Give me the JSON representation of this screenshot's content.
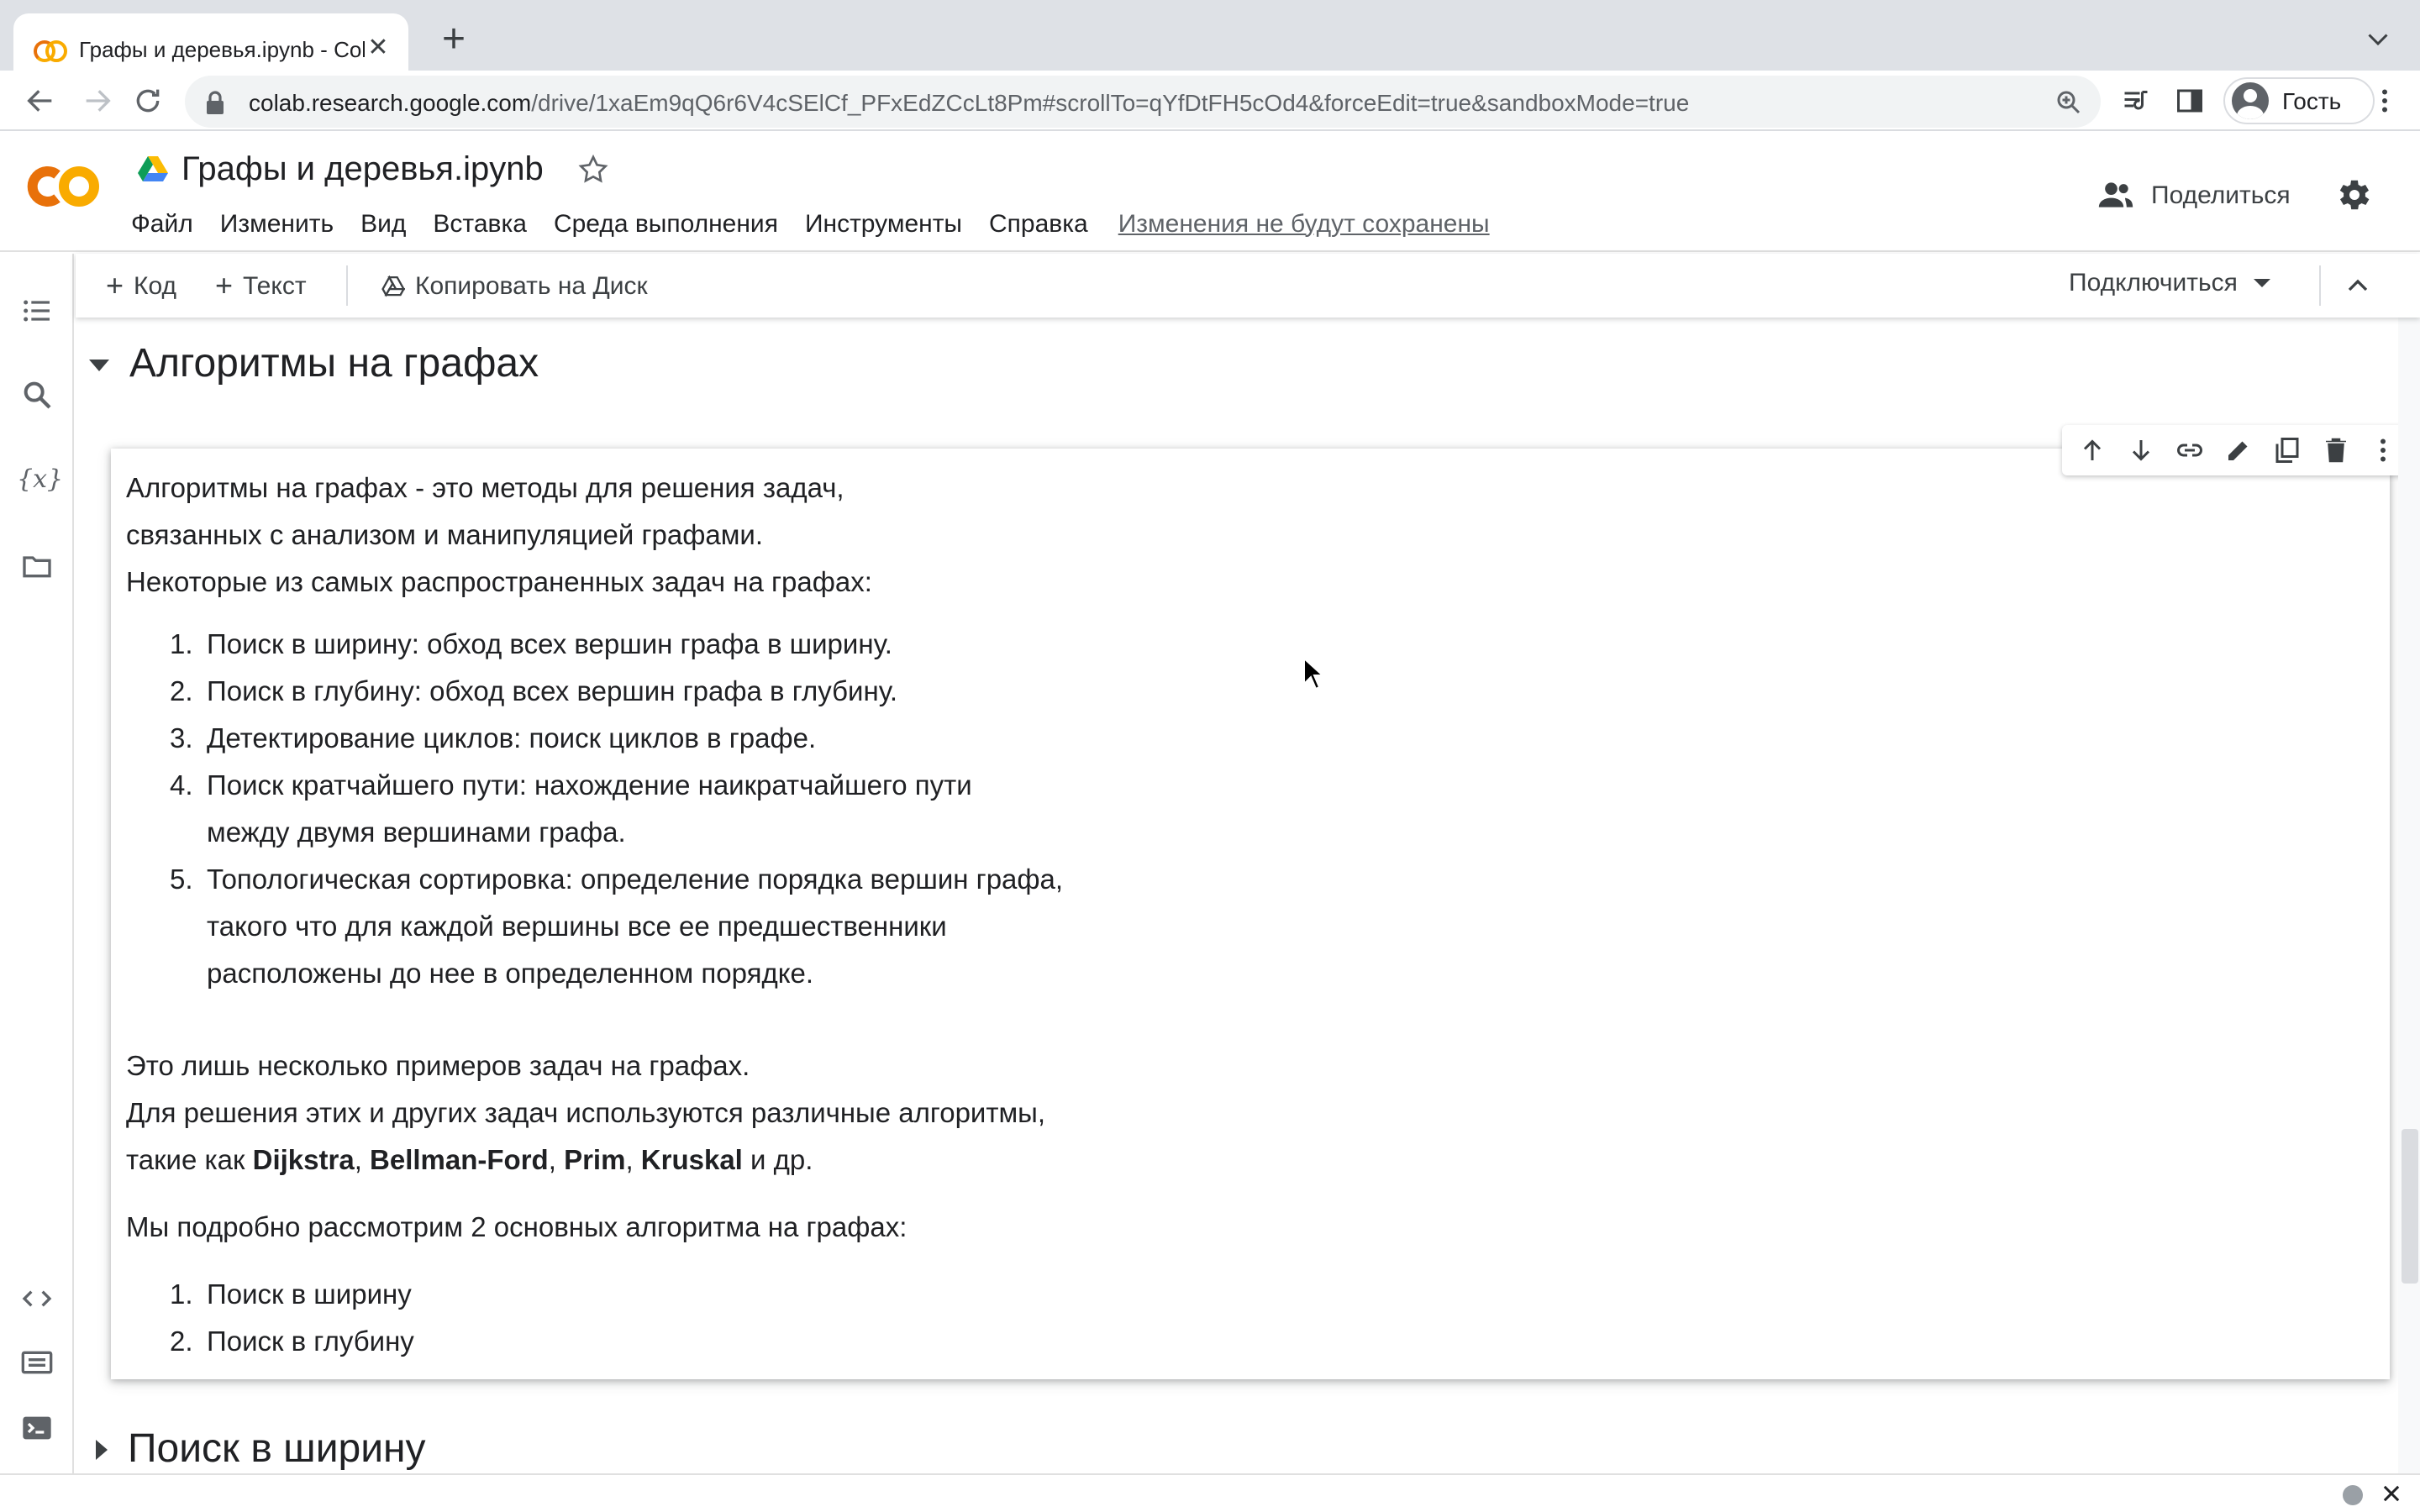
{
  "browser": {
    "tab_title": "Графы и деревья.ipynb - Cola",
    "url_host": "colab.research.google.com",
    "url_path": "/drive/1xaEm9qQ6r6V4cSElCf_PFxEdZCcLt8Pm#scrollTo=qYfDtFH5cOd4&forceEdit=true&sandboxMode=true",
    "profile_name": "Гость"
  },
  "colab": {
    "notebook_title": "Графы и деревья.ipynb",
    "menu": [
      "Файл",
      "Изменить",
      "Вид",
      "Вставка",
      "Среда выполнения",
      "Инструменты",
      "Справка"
    ],
    "unsaved_notice": "Изменения не будут сохранены",
    "share_label": "Поделиться",
    "toolbar": {
      "add_code": "Код",
      "add_text": "Текст",
      "copy_to_drive": "Копировать на Диск",
      "connect": "Подключиться"
    }
  },
  "content": {
    "section_title": "Алгоритмы на графах",
    "intro": [
      "Алгоритмы на графах - это методы для решения задач,",
      "связанных с анализом и манипуляцией графами.",
      "Некоторые из самых распространенных задач на графах:"
    ],
    "tasks": [
      {
        "num": "1.",
        "lines": [
          "Поиск в ширину: обход всех вершин графа в ширину."
        ]
      },
      {
        "num": "2.",
        "lines": [
          "Поиск в глубину: обход всех вершин графа в глубину."
        ]
      },
      {
        "num": "3.",
        "lines": [
          "Детектирование циклов: поиск циклов в графе."
        ]
      },
      {
        "num": "4.",
        "lines": [
          "Поиск кратчайшего пути: нахождение наикратчайшего пути",
          "между двумя вершинами графа."
        ]
      },
      {
        "num": "5.",
        "lines": [
          "Топологическая сортировка: определение порядка вершин графа,",
          "такого что для каждой вершины все ее предшественники",
          "расположены до нее в определенном порядке."
        ]
      }
    ],
    "outro_line1": "Это лишь несколько примеров задач на графах.",
    "outro_line2": "Для решения этих и других задач используются различные алгоритмы,",
    "outro_line3_prefix": "такие как ",
    "algorithms": [
      "Dijkstra",
      "Bellman-Ford",
      "Prim",
      "Kruskal"
    ],
    "outro_line3_sep": ", ",
    "outro_line3_suffix": " и др.",
    "plan_intro": "Мы подробно рассмотрим 2 основных алгоритма на графах:",
    "plan": [
      {
        "num": "1.",
        "text": "Поиск в ширину"
      },
      {
        "num": "2.",
        "text": "Поиск в глубину"
      }
    ],
    "next_section_title": "Поиск в ширину"
  }
}
